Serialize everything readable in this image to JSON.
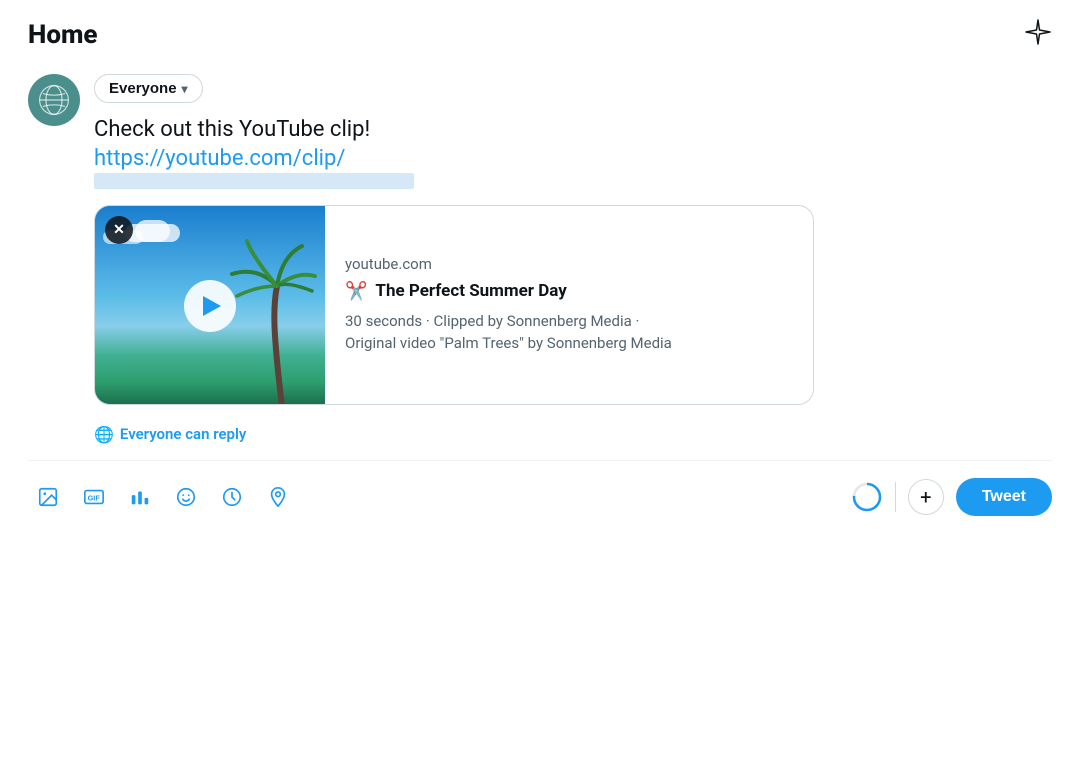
{
  "header": {
    "title": "Home",
    "sparkle_label": "✦"
  },
  "composer": {
    "everyone_label": "Everyone",
    "tweet_text": "Check out this YouTube clip!",
    "tweet_link": "https://youtube.com/clip/",
    "everyone_reply_label": "Everyone can reply"
  },
  "preview_card": {
    "source": "youtube.com",
    "title": "The Perfect Summer Day",
    "meta": "30 seconds · Clipped by Sonnenberg Media ·\nOriginal video \"Palm Trees\" by Sonnenberg Media",
    "close_label": "✕"
  },
  "toolbar": {
    "tweet_label": "Tweet",
    "add_label": "+"
  },
  "toolbar_icons": [
    {
      "name": "image-icon",
      "label": "Image"
    },
    {
      "name": "gif-icon",
      "label": "GIF"
    },
    {
      "name": "poll-icon",
      "label": "Poll"
    },
    {
      "name": "emoji-icon",
      "label": "Emoji"
    },
    {
      "name": "schedule-icon",
      "label": "Schedule"
    },
    {
      "name": "location-icon",
      "label": "Location"
    }
  ]
}
